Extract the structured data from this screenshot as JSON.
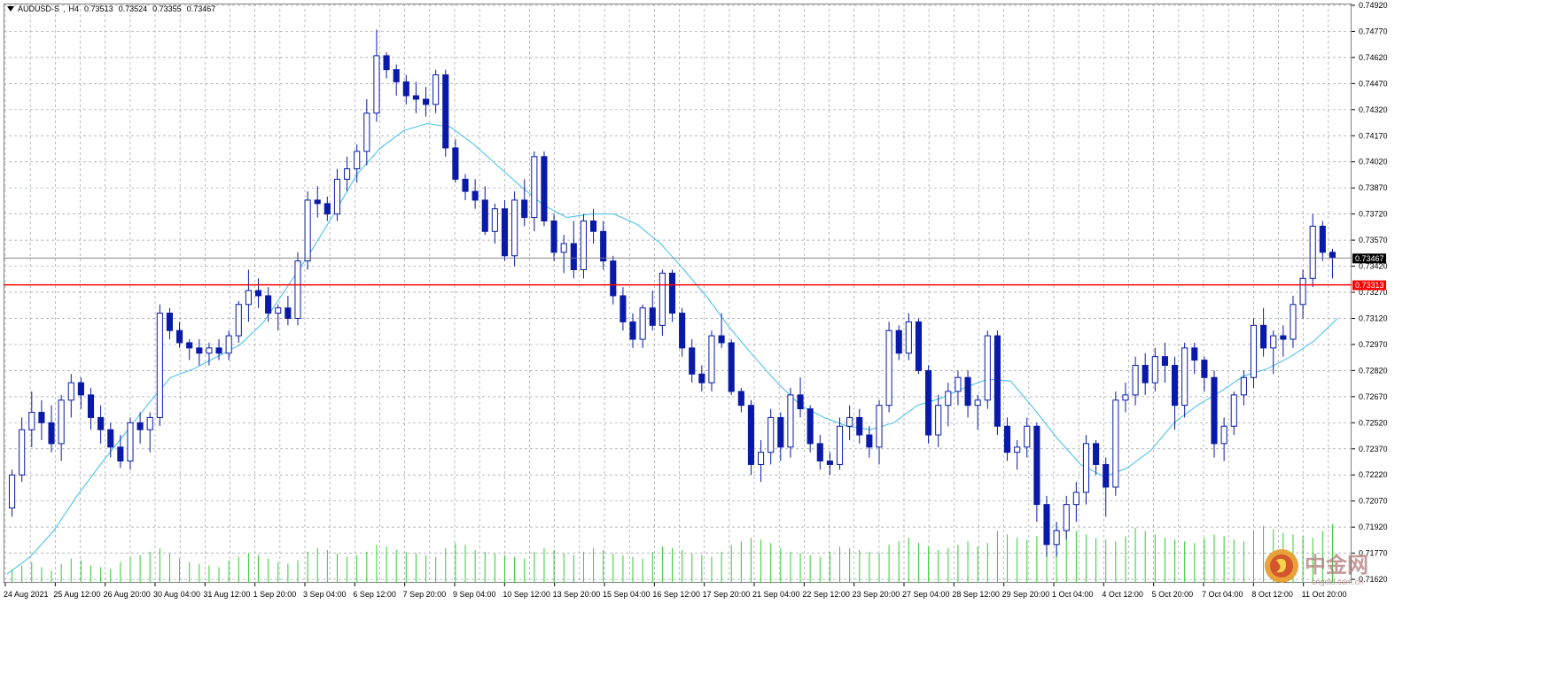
{
  "header": {
    "symbol": "AUDUSD-S",
    "timeframe": "H4",
    "open": "0.73513",
    "high": "0.73524",
    "low": "0.73355",
    "close": "0.73467"
  },
  "markers": {
    "current_price": "0.73467",
    "horizontal_line": "0.73313",
    "horizontal_line_color": "#ff0000",
    "current_price_bg": "#000000"
  },
  "colors": {
    "background": "#ffffff",
    "grid": "#9aa0a8",
    "candle": "#0a1aa8",
    "moving_average": "#4fc3e8",
    "volume": "#33cc33"
  },
  "watermark": {
    "brand": "中金网",
    "url": "cngold.com.cn"
  },
  "chart_data": {
    "type": "candlestick",
    "price_axis_ticks": [
      "0.74920",
      "0.74770",
      "0.74620",
      "0.74470",
      "0.74320",
      "0.74170",
      "0.74020",
      "0.73870",
      "0.73720",
      "0.73570",
      "0.73420",
      "0.73270",
      "0.73120",
      "0.72970",
      "0.72820",
      "0.72670",
      "0.72520",
      "0.72370",
      "0.72220",
      "0.72070",
      "0.71920",
      "0.71770",
      "0.71620"
    ],
    "ylim": [
      0.716,
      0.7493
    ],
    "time_axis_labels": [
      "24 Aug 2021",
      "25 Aug 12:00",
      "26 Aug 20:00",
      "30 Aug 04:00",
      "31 Aug 12:00",
      "1 Sep 20:00",
      "3 Sep 04:00",
      "6 Sep 12:00",
      "7 Sep 20:00",
      "9 Sep 04:00",
      "10 Sep 12:00",
      "13 Sep 20:00",
      "15 Sep 04:00",
      "16 Sep 12:00",
      "17 Sep 20:00",
      "21 Sep 04:00",
      "22 Sep 12:00",
      "23 Sep 20:00",
      "27 Sep 04:00",
      "28 Sep 12:00",
      "29 Sep 20:00",
      "1 Oct 04:00",
      "4 Oct 12:00",
      "5 Oct 20:00",
      "7 Oct 04:00",
      "8 Oct 12:00",
      "11 Oct 20:00"
    ],
    "moving_average": [
      0.7165,
      0.7175,
      0.719,
      0.721,
      0.7228,
      0.7245,
      0.7262,
      0.7278,
      0.7283,
      0.729,
      0.7297,
      0.731,
      0.733,
      0.735,
      0.7372,
      0.7395,
      0.741,
      0.742,
      0.7424,
      0.7422,
      0.7412,
      0.74,
      0.7388,
      0.7377,
      0.737,
      0.7372,
      0.7372,
      0.7366,
      0.7355,
      0.734,
      0.7324,
      0.7306,
      0.729,
      0.7275,
      0.7262,
      0.7255,
      0.725,
      0.7248,
      0.7252,
      0.7262,
      0.7266,
      0.7272,
      0.7277,
      0.7276,
      0.726,
      0.7243,
      0.7228,
      0.7221,
      0.7226,
      0.7236,
      0.7252,
      0.7262,
      0.727,
      0.7279,
      0.7283,
      0.729,
      0.7299,
      0.7312
    ],
    "candles": [
      [
        0.7203,
        0.7225,
        0.7198,
        0.7222
      ],
      [
        0.7222,
        0.7255,
        0.7218,
        0.7248
      ],
      [
        0.7248,
        0.727,
        0.7238,
        0.7258
      ],
      [
        0.7258,
        0.7265,
        0.7242,
        0.7252
      ],
      [
        0.7252,
        0.7262,
        0.7235,
        0.724
      ],
      [
        0.724,
        0.7268,
        0.723,
        0.7265
      ],
      [
        0.7265,
        0.728,
        0.7255,
        0.7275
      ],
      [
        0.7275,
        0.7278,
        0.726,
        0.7268
      ],
      [
        0.7268,
        0.7272,
        0.7248,
        0.7255
      ],
      [
        0.7255,
        0.7262,
        0.724,
        0.7248
      ],
      [
        0.7248,
        0.7252,
        0.7232,
        0.7238
      ],
      [
        0.7238,
        0.7245,
        0.7226,
        0.723
      ],
      [
        0.723,
        0.7255,
        0.7225,
        0.7252
      ],
      [
        0.7252,
        0.7258,
        0.724,
        0.7248
      ],
      [
        0.7248,
        0.7258,
        0.7235,
        0.7255
      ],
      [
        0.7255,
        0.732,
        0.725,
        0.7315
      ],
      [
        0.7315,
        0.7318,
        0.73,
        0.7305
      ],
      [
        0.7305,
        0.731,
        0.7295,
        0.7298
      ],
      [
        0.7298,
        0.73,
        0.7288,
        0.7295
      ],
      [
        0.7295,
        0.73,
        0.7285,
        0.7292
      ],
      [
        0.7292,
        0.7298,
        0.7285,
        0.7295
      ],
      [
        0.7295,
        0.73,
        0.7288,
        0.7292
      ],
      [
        0.7292,
        0.7305,
        0.7288,
        0.7302
      ],
      [
        0.7302,
        0.7322,
        0.7298,
        0.732
      ],
      [
        0.732,
        0.734,
        0.731,
        0.7328
      ],
      [
        0.7328,
        0.7335,
        0.7318,
        0.7325
      ],
      [
        0.7325,
        0.733,
        0.731,
        0.7315
      ],
      [
        0.7315,
        0.732,
        0.7305,
        0.7318
      ],
      [
        0.7318,
        0.7325,
        0.7308,
        0.7312
      ],
      [
        0.7312,
        0.735,
        0.7308,
        0.7345
      ],
      [
        0.7345,
        0.7385,
        0.734,
        0.738
      ],
      [
        0.738,
        0.7388,
        0.737,
        0.7378
      ],
      [
        0.7378,
        0.7382,
        0.7368,
        0.7372
      ],
      [
        0.7372,
        0.7398,
        0.7368,
        0.7392
      ],
      [
        0.7392,
        0.7405,
        0.7385,
        0.7398
      ],
      [
        0.7398,
        0.7412,
        0.739,
        0.7408
      ],
      [
        0.7408,
        0.7438,
        0.74,
        0.743
      ],
      [
        0.743,
        0.7478,
        0.7425,
        0.7463
      ],
      [
        0.7463,
        0.7465,
        0.745,
        0.7455
      ],
      [
        0.7455,
        0.7458,
        0.744,
        0.7448
      ],
      [
        0.7448,
        0.7452,
        0.7435,
        0.744
      ],
      [
        0.744,
        0.7448,
        0.743,
        0.7438
      ],
      [
        0.7438,
        0.7445,
        0.7428,
        0.7435
      ],
      [
        0.7435,
        0.7455,
        0.743,
        0.7452
      ],
      [
        0.7452,
        0.7455,
        0.7405,
        0.741
      ],
      [
        0.741,
        0.7415,
        0.739,
        0.7392
      ],
      [
        0.7392,
        0.7395,
        0.738,
        0.7385
      ],
      [
        0.7385,
        0.7392,
        0.7375,
        0.738
      ],
      [
        0.738,
        0.7388,
        0.736,
        0.7362
      ],
      [
        0.7362,
        0.7378,
        0.7355,
        0.7375
      ],
      [
        0.7375,
        0.738,
        0.7345,
        0.7348
      ],
      [
        0.7348,
        0.7385,
        0.7342,
        0.738
      ],
      [
        0.738,
        0.7392,
        0.7365,
        0.737
      ],
      [
        0.737,
        0.7408,
        0.7362,
        0.7405
      ],
      [
        0.7405,
        0.7408,
        0.7365,
        0.7368
      ],
      [
        0.7368,
        0.7372,
        0.7345,
        0.735
      ],
      [
        0.735,
        0.736,
        0.7338,
        0.7355
      ],
      [
        0.7355,
        0.7368,
        0.7335,
        0.734
      ],
      [
        0.734,
        0.7372,
        0.7335,
        0.7368
      ],
      [
        0.7368,
        0.7375,
        0.7355,
        0.7362
      ],
      [
        0.7362,
        0.7368,
        0.734,
        0.7345
      ],
      [
        0.7345,
        0.7348,
        0.732,
        0.7325
      ],
      [
        0.7325,
        0.733,
        0.7305,
        0.731
      ],
      [
        0.731,
        0.7315,
        0.7295,
        0.73
      ],
      [
        0.73,
        0.732,
        0.7295,
        0.7318
      ],
      [
        0.7318,
        0.7328,
        0.7305,
        0.7308
      ],
      [
        0.7308,
        0.734,
        0.7302,
        0.7338
      ],
      [
        0.7338,
        0.734,
        0.731,
        0.7315
      ],
      [
        0.7315,
        0.7318,
        0.729,
        0.7295
      ],
      [
        0.7295,
        0.73,
        0.7275,
        0.728
      ],
      [
        0.728,
        0.7285,
        0.727,
        0.7275
      ],
      [
        0.7275,
        0.7305,
        0.727,
        0.7302
      ],
      [
        0.7302,
        0.7315,
        0.7295,
        0.7298
      ],
      [
        0.7298,
        0.73,
        0.7268,
        0.727
      ],
      [
        0.727,
        0.7272,
        0.7258,
        0.7262
      ],
      [
        0.7262,
        0.7265,
        0.7222,
        0.7228
      ],
      [
        0.7228,
        0.7242,
        0.7218,
        0.7235
      ],
      [
        0.7235,
        0.726,
        0.7228,
        0.7255
      ],
      [
        0.7255,
        0.7258,
        0.723,
        0.7238
      ],
      [
        0.7238,
        0.7272,
        0.7232,
        0.7268
      ],
      [
        0.7268,
        0.7278,
        0.7255,
        0.726
      ],
      [
        0.726,
        0.7262,
        0.7235,
        0.724
      ],
      [
        0.724,
        0.7245,
        0.7225,
        0.723
      ],
      [
        0.723,
        0.7235,
        0.7222,
        0.7228
      ],
      [
        0.7228,
        0.7255,
        0.7225,
        0.725
      ],
      [
        0.725,
        0.7262,
        0.7242,
        0.7255
      ],
      [
        0.7255,
        0.726,
        0.724,
        0.7245
      ],
      [
        0.7245,
        0.725,
        0.7232,
        0.7238
      ],
      [
        0.7238,
        0.7265,
        0.7228,
        0.7262
      ],
      [
        0.7262,
        0.731,
        0.7258,
        0.7305
      ],
      [
        0.7305,
        0.7308,
        0.7288,
        0.7292
      ],
      [
        0.7292,
        0.7315,
        0.7288,
        0.731
      ],
      [
        0.731,
        0.7312,
        0.728,
        0.7282
      ],
      [
        0.7282,
        0.7285,
        0.724,
        0.7245
      ],
      [
        0.7245,
        0.7268,
        0.7238,
        0.7262
      ],
      [
        0.7262,
        0.7275,
        0.725,
        0.727
      ],
      [
        0.727,
        0.7282,
        0.7262,
        0.7278
      ],
      [
        0.7278,
        0.7282,
        0.7255,
        0.7262
      ],
      [
        0.7262,
        0.7268,
        0.7248,
        0.7265
      ],
      [
        0.7265,
        0.7305,
        0.726,
        0.7302
      ],
      [
        0.7302,
        0.7305,
        0.7245,
        0.725
      ],
      [
        0.725,
        0.7255,
        0.723,
        0.7235
      ],
      [
        0.7235,
        0.7242,
        0.7225,
        0.7238
      ],
      [
        0.7238,
        0.7255,
        0.7232,
        0.725
      ],
      [
        0.725,
        0.7252,
        0.7195,
        0.7205
      ],
      [
        0.7205,
        0.721,
        0.7175,
        0.7182
      ],
      [
        0.7182,
        0.7195,
        0.7175,
        0.719
      ],
      [
        0.719,
        0.721,
        0.7185,
        0.7205
      ],
      [
        0.7205,
        0.7218,
        0.7195,
        0.7212
      ],
      [
        0.7212,
        0.7245,
        0.7205,
        0.724
      ],
      [
        0.724,
        0.7242,
        0.7222,
        0.7228
      ],
      [
        0.7228,
        0.7232,
        0.7198,
        0.7215
      ],
      [
        0.7215,
        0.727,
        0.721,
        0.7265
      ],
      [
        0.7265,
        0.7275,
        0.7258,
        0.7268
      ],
      [
        0.7268,
        0.729,
        0.7262,
        0.7285
      ],
      [
        0.7285,
        0.7292,
        0.7268,
        0.7275
      ],
      [
        0.7275,
        0.7295,
        0.727,
        0.729
      ],
      [
        0.729,
        0.7298,
        0.7275,
        0.7285
      ],
      [
        0.7285,
        0.729,
        0.7248,
        0.7262
      ],
      [
        0.7262,
        0.7298,
        0.7255,
        0.7295
      ],
      [
        0.7295,
        0.7298,
        0.728,
        0.7288
      ],
      [
        0.7288,
        0.729,
        0.727,
        0.7278
      ],
      [
        0.7278,
        0.7282,
        0.7232,
        0.724
      ],
      [
        0.724,
        0.7255,
        0.723,
        0.725
      ],
      [
        0.725,
        0.727,
        0.7245,
        0.7268
      ],
      [
        0.7268,
        0.7282,
        0.7262,
        0.7278
      ],
      [
        0.7278,
        0.7312,
        0.7272,
        0.7308
      ],
      [
        0.7308,
        0.7318,
        0.729,
        0.7295
      ],
      [
        0.7295,
        0.7305,
        0.728,
        0.7302
      ],
      [
        0.7302,
        0.7308,
        0.729,
        0.73
      ],
      [
        0.73,
        0.7325,
        0.7295,
        0.732
      ],
      [
        0.732,
        0.734,
        0.7312,
        0.7335
      ],
      [
        0.7335,
        0.7372,
        0.733,
        0.7365
      ],
      [
        0.7365,
        0.7368,
        0.7345,
        0.735
      ],
      [
        0.735,
        0.7352,
        0.7335,
        0.7347
      ]
    ],
    "volume": [
      8,
      10,
      12,
      9,
      7,
      11,
      14,
      13,
      10,
      9,
      8,
      12,
      15,
      16,
      18,
      20,
      17,
      14,
      12,
      11,
      10,
      9,
      13,
      15,
      17,
      16,
      14,
      12,
      11,
      13,
      18,
      20,
      19,
      17,
      15,
      16,
      18,
      22,
      21,
      19,
      18,
      17,
      16,
      15,
      20,
      23,
      22,
      19,
      18,
      17,
      16,
      15,
      14,
      18,
      20,
      19,
      17,
      16,
      18,
      20,
      19,
      17,
      16,
      15,
      14,
      18,
      21,
      20,
      19,
      17,
      16,
      15,
      18,
      22,
      24,
      26,
      25,
      23,
      20,
      18,
      17,
      16,
      15,
      18,
      21,
      20,
      19,
      18,
      17,
      22,
      24,
      26,
      23,
      21,
      19,
      20,
      22,
      24,
      21,
      23,
      30,
      28,
      26,
      25,
      27,
      40,
      35,
      33,
      30,
      28,
      26,
      25,
      24,
      27,
      32,
      30,
      28,
      26,
      25,
      24,
      23,
      26,
      28,
      27,
      25,
      24,
      30,
      33,
      31,
      29,
      28,
      27,
      26,
      30,
      34,
      33,
      31
    ]
  }
}
